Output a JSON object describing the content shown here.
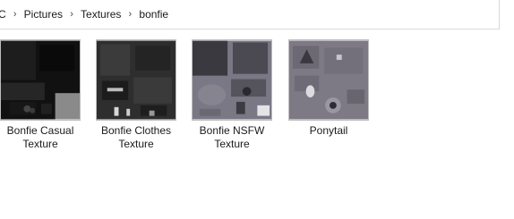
{
  "breadcrumb": {
    "items": [
      "C",
      "Pictures",
      "Textures",
      "bonfie"
    ]
  },
  "files": [
    {
      "name_line1": "Bonfie Casual",
      "name_line2": "Texture",
      "icon": "image-thumbnail"
    },
    {
      "name_line1": "Bonfie Clothes",
      "name_line2": "Texture",
      "icon": "image-thumbnail"
    },
    {
      "name_line1": "Bonfie NSFW",
      "name_line2": "Texture",
      "icon": "image-thumbnail"
    },
    {
      "name_line1": "Ponytail",
      "name_line2": "",
      "icon": "image-thumbnail"
    }
  ],
  "colors": {
    "background": "#ffffff",
    "thumb_border": "#bdbdbd",
    "text": "#1a1a1a"
  }
}
